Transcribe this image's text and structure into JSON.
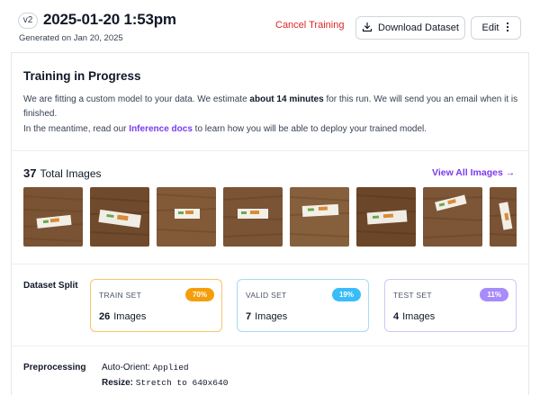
{
  "header": {
    "version": "v2",
    "title": "2025-01-20 1:53pm",
    "subtitle": "Generated on Jan 20, 2025",
    "cancel_label": "Cancel Training",
    "download_label": "Download Dataset",
    "edit_label": "Edit"
  },
  "training": {
    "title": "Training in Progress",
    "para1_a": "We are fitting a custom model to your data. We estimate ",
    "para1_bold": "about 14 minutes",
    "para1_b": " for this run. We will send you an email when it is finished.",
    "para2_a": "In the meantime, read our ",
    "para2_link": "Inference docs",
    "para2_b": " to learn how you will be able to deploy your trained model."
  },
  "images": {
    "count": "37",
    "label": "Total Images",
    "view_all": "View All Images →"
  },
  "split": {
    "label": "Dataset Split",
    "cards": [
      {
        "name": "TRAIN SET",
        "pct": "70%",
        "count": "26",
        "unit": "Images",
        "color": "#f59e0b"
      },
      {
        "name": "VALID SET",
        "pct": "19%",
        "count": "7",
        "unit": "Images",
        "color": "#38bdf8"
      },
      {
        "name": "TEST SET",
        "pct": "11%",
        "count": "4",
        "unit": "Images",
        "color": "#a78bfa"
      }
    ]
  },
  "preprocessing": {
    "label": "Preprocessing",
    "items": [
      {
        "key": "Auto-Orient:",
        "value": "Applied"
      },
      {
        "key": "Resize:",
        "value": "Stretch to 640x640"
      }
    ]
  },
  "colors": {
    "accent": "#7c3aed",
    "danger": "#dc2626"
  }
}
